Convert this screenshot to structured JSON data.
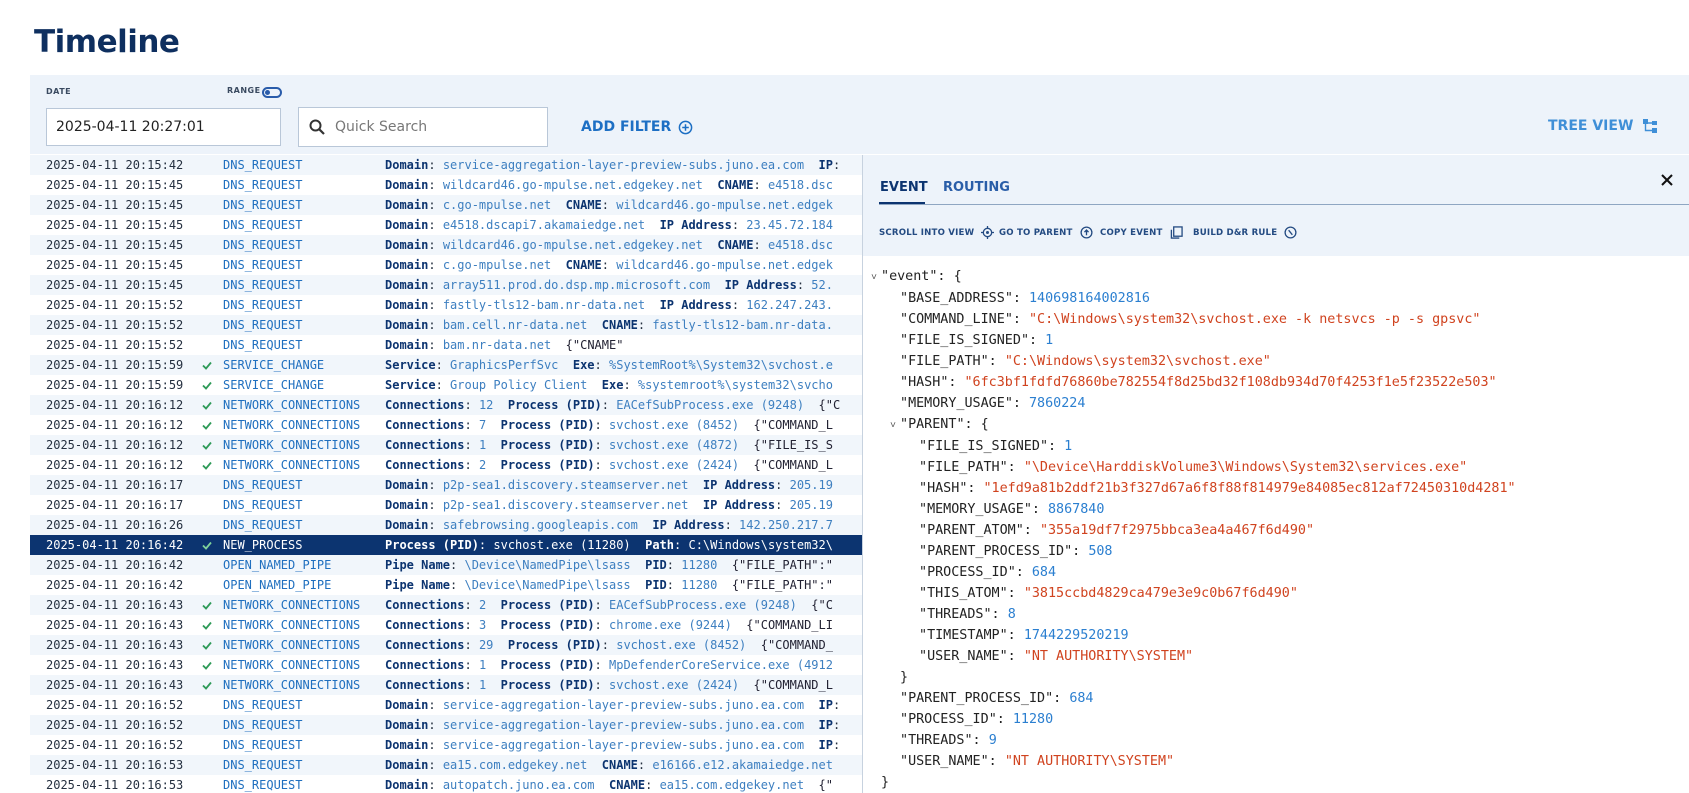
{
  "page": {
    "title": "Timeline"
  },
  "toolbar": {
    "date_label": "DATE",
    "range_label": "RANGE",
    "date_value": "2025-04-11 20:27:01",
    "search_placeholder": "Quick Search",
    "add_filter_label": "ADD FILTER",
    "tree_view_label": "TREE VIEW"
  },
  "events": [
    {
      "ts": "2025-04-11 20:15:42",
      "check": false,
      "type": "DNS_REQUEST",
      "fields": [
        [
          "Domain",
          "service-aggregation-layer-preview-subs.juno.ea.com"
        ],
        [
          "IP",
          ""
        ]
      ],
      "raw": ""
    },
    {
      "ts": "2025-04-11 20:15:45",
      "check": false,
      "type": "DNS_REQUEST",
      "fields": [
        [
          "Domain",
          "wildcard46.go-mpulse.net.edgekey.net"
        ],
        [
          "CNAME",
          "e4518.dsc"
        ]
      ],
      "raw": ""
    },
    {
      "ts": "2025-04-11 20:15:45",
      "check": false,
      "type": "DNS_REQUEST",
      "fields": [
        [
          "Domain",
          "c.go-mpulse.net"
        ],
        [
          "CNAME",
          "wildcard46.go-mpulse.net.edgek"
        ]
      ],
      "raw": ""
    },
    {
      "ts": "2025-04-11 20:15:45",
      "check": false,
      "type": "DNS_REQUEST",
      "fields": [
        [
          "Domain",
          "e4518.dscapi7.akamaiedge.net"
        ],
        [
          "IP Address",
          "23.45.72.184"
        ]
      ],
      "raw": ""
    },
    {
      "ts": "2025-04-11 20:15:45",
      "check": false,
      "type": "DNS_REQUEST",
      "fields": [
        [
          "Domain",
          "wildcard46.go-mpulse.net.edgekey.net"
        ],
        [
          "CNAME",
          "e4518.dsc"
        ]
      ],
      "raw": ""
    },
    {
      "ts": "2025-04-11 20:15:45",
      "check": false,
      "type": "DNS_REQUEST",
      "fields": [
        [
          "Domain",
          "c.go-mpulse.net"
        ],
        [
          "CNAME",
          "wildcard46.go-mpulse.net.edgek"
        ]
      ],
      "raw": ""
    },
    {
      "ts": "2025-04-11 20:15:45",
      "check": false,
      "type": "DNS_REQUEST",
      "fields": [
        [
          "Domain",
          "array511.prod.do.dsp.mp.microsoft.com"
        ],
        [
          "IP Address",
          "52."
        ]
      ],
      "raw": ""
    },
    {
      "ts": "2025-04-11 20:15:52",
      "check": false,
      "type": "DNS_REQUEST",
      "fields": [
        [
          "Domain",
          "fastly-tls12-bam.nr-data.net"
        ],
        [
          "IP Address",
          "162.247.243."
        ]
      ],
      "raw": ""
    },
    {
      "ts": "2025-04-11 20:15:52",
      "check": false,
      "type": "DNS_REQUEST",
      "fields": [
        [
          "Domain",
          "bam.cell.nr-data.net"
        ],
        [
          "CNAME",
          "fastly-tls12-bam.nr-data."
        ]
      ],
      "raw": ""
    },
    {
      "ts": "2025-04-11 20:15:52",
      "check": false,
      "type": "DNS_REQUEST",
      "fields": [
        [
          "Domain",
          "bam.nr-data.net"
        ]
      ],
      "raw": "{\"CNAME\""
    },
    {
      "ts": "2025-04-11 20:15:59",
      "check": true,
      "type": "SERVICE_CHANGE",
      "fields": [
        [
          "Service",
          "GraphicsPerfSvc"
        ],
        [
          "Exe",
          "%SystemRoot%\\System32\\svchost.e"
        ]
      ],
      "raw": ""
    },
    {
      "ts": "2025-04-11 20:15:59",
      "check": true,
      "type": "SERVICE_CHANGE",
      "fields": [
        [
          "Service",
          "Group Policy Client"
        ],
        [
          "Exe",
          "%systemroot%\\system32\\svcho"
        ]
      ],
      "raw": ""
    },
    {
      "ts": "2025-04-11 20:16:12",
      "check": true,
      "type": "NETWORK_CONNECTIONS",
      "fields": [
        [
          "Connections",
          "12"
        ],
        [
          "Process (PID)",
          "EACefSubProcess.exe (9248)"
        ]
      ],
      "raw": "{\"C"
    },
    {
      "ts": "2025-04-11 20:16:12",
      "check": true,
      "type": "NETWORK_CONNECTIONS",
      "fields": [
        [
          "Connections",
          "7"
        ],
        [
          "Process (PID)",
          "svchost.exe (8452)"
        ]
      ],
      "raw": "{\"COMMAND_L"
    },
    {
      "ts": "2025-04-11 20:16:12",
      "check": true,
      "type": "NETWORK_CONNECTIONS",
      "fields": [
        [
          "Connections",
          "1"
        ],
        [
          "Process (PID)",
          "svchost.exe (4872)"
        ]
      ],
      "raw": "{\"FILE_IS_S"
    },
    {
      "ts": "2025-04-11 20:16:12",
      "check": true,
      "type": "NETWORK_CONNECTIONS",
      "fields": [
        [
          "Connections",
          "2"
        ],
        [
          "Process (PID)",
          "svchost.exe (2424)"
        ]
      ],
      "raw": "{\"COMMAND_L"
    },
    {
      "ts": "2025-04-11 20:16:17",
      "check": false,
      "type": "DNS_REQUEST",
      "fields": [
        [
          "Domain",
          "p2p-sea1.discovery.steamserver.net"
        ],
        [
          "IP Address",
          "205.19"
        ]
      ],
      "raw": ""
    },
    {
      "ts": "2025-04-11 20:16:17",
      "check": false,
      "type": "DNS_REQUEST",
      "fields": [
        [
          "Domain",
          "p2p-sea1.discovery.steamserver.net"
        ],
        [
          "IP Address",
          "205.19"
        ]
      ],
      "raw": ""
    },
    {
      "ts": "2025-04-11 20:16:26",
      "check": false,
      "type": "DNS_REQUEST",
      "fields": [
        [
          "Domain",
          "safebrowsing.googleapis.com"
        ],
        [
          "IP Address",
          "142.250.217.7"
        ]
      ],
      "raw": ""
    },
    {
      "ts": "2025-04-11 20:16:42",
      "check": true,
      "type": "NEW_PROCESS",
      "selected": true,
      "fields": [
        [
          "Process (PID)",
          "svchost.exe (11280)"
        ],
        [
          "Path",
          "C:\\Windows\\system32\\"
        ]
      ],
      "raw": ""
    },
    {
      "ts": "2025-04-11 20:16:42",
      "check": false,
      "type": "OPEN_NAMED_PIPE",
      "fields": [
        [
          "Pipe Name",
          "\\Device\\NamedPipe\\lsass"
        ],
        [
          "PID",
          "11280"
        ]
      ],
      "raw": "{\"FILE_PATH\":\""
    },
    {
      "ts": "2025-04-11 20:16:42",
      "check": false,
      "type": "OPEN_NAMED_PIPE",
      "fields": [
        [
          "Pipe Name",
          "\\Device\\NamedPipe\\lsass"
        ],
        [
          "PID",
          "11280"
        ]
      ],
      "raw": "{\"FILE_PATH\":\""
    },
    {
      "ts": "2025-04-11 20:16:43",
      "check": true,
      "type": "NETWORK_CONNECTIONS",
      "fields": [
        [
          "Connections",
          "2"
        ],
        [
          "Process (PID)",
          "EACefSubProcess.exe (9248)"
        ]
      ],
      "raw": "{\"C"
    },
    {
      "ts": "2025-04-11 20:16:43",
      "check": true,
      "type": "NETWORK_CONNECTIONS",
      "fields": [
        [
          "Connections",
          "3"
        ],
        [
          "Process (PID)",
          "chrome.exe (9244)"
        ]
      ],
      "raw": "{\"COMMAND_LI"
    },
    {
      "ts": "2025-04-11 20:16:43",
      "check": true,
      "type": "NETWORK_CONNECTIONS",
      "fields": [
        [
          "Connections",
          "29"
        ],
        [
          "Process (PID)",
          "svchost.exe (8452)"
        ]
      ],
      "raw": "{\"COMMAND_"
    },
    {
      "ts": "2025-04-11 20:16:43",
      "check": true,
      "type": "NETWORK_CONNECTIONS",
      "fields": [
        [
          "Connections",
          "1"
        ],
        [
          "Process (PID)",
          "MpDefenderCoreService.exe (4912"
        ]
      ],
      "raw": ""
    },
    {
      "ts": "2025-04-11 20:16:43",
      "check": true,
      "type": "NETWORK_CONNECTIONS",
      "fields": [
        [
          "Connections",
          "1"
        ],
        [
          "Process (PID)",
          "svchost.exe (2424)"
        ]
      ],
      "raw": "{\"COMMAND_L"
    },
    {
      "ts": "2025-04-11 20:16:52",
      "check": false,
      "type": "DNS_REQUEST",
      "fields": [
        [
          "Domain",
          "service-aggregation-layer-preview-subs.juno.ea.com"
        ],
        [
          "IP",
          ""
        ]
      ],
      "raw": ""
    },
    {
      "ts": "2025-04-11 20:16:52",
      "check": false,
      "type": "DNS_REQUEST",
      "fields": [
        [
          "Domain",
          "service-aggregation-layer-preview-subs.juno.ea.com"
        ],
        [
          "IP",
          ""
        ]
      ],
      "raw": ""
    },
    {
      "ts": "2025-04-11 20:16:52",
      "check": false,
      "type": "DNS_REQUEST",
      "fields": [
        [
          "Domain",
          "service-aggregation-layer-preview-subs.juno.ea.com"
        ],
        [
          "IP",
          ""
        ]
      ],
      "raw": ""
    },
    {
      "ts": "2025-04-11 20:16:53",
      "check": false,
      "type": "DNS_REQUEST",
      "fields": [
        [
          "Domain",
          "ea15.com.edgekey.net"
        ],
        [
          "CNAME",
          "e16166.e12.akamaiedge.net"
        ]
      ],
      "raw": ""
    },
    {
      "ts": "2025-04-11 20:16:53",
      "check": false,
      "type": "DNS_REQUEST",
      "fields": [
        [
          "Domain",
          "autopatch.juno.ea.com"
        ],
        [
          "CNAME",
          "ea15.com.edgekey.net"
        ]
      ],
      "raw": "{\""
    }
  ],
  "panel": {
    "tabs": [
      "EVENT",
      "ROUTING"
    ],
    "actions": [
      "SCROLL INTO VIEW",
      "GO TO PARENT",
      "COPY EVENT",
      "BUILD D&R RULE"
    ],
    "json_lines": [
      {
        "indent": 0,
        "caret": true,
        "key": "event",
        "open": "{"
      },
      {
        "indent": 1,
        "key": "BASE_ADDRESS",
        "val": "140698164002816",
        "t": "n"
      },
      {
        "indent": 1,
        "key": "COMMAND_LINE",
        "val": "\"C:\\Windows\\system32\\svchost.exe -k netsvcs -p -s gpsvc\"",
        "t": "s"
      },
      {
        "indent": 1,
        "key": "FILE_IS_SIGNED",
        "val": "1",
        "t": "n"
      },
      {
        "indent": 1,
        "key": "FILE_PATH",
        "val": "\"C:\\Windows\\system32\\svchost.exe\"",
        "t": "s"
      },
      {
        "indent": 1,
        "key": "HASH",
        "val": "\"6fc3bf1fdfd76860be782554f8d25bd32f108db934d70f4253f1e5f23522e503\"",
        "t": "s"
      },
      {
        "indent": 1,
        "key": "MEMORY_USAGE",
        "val": "7860224",
        "t": "n"
      },
      {
        "indent": 1,
        "caret": true,
        "key": "PARENT",
        "open": "{"
      },
      {
        "indent": 2,
        "key": "FILE_IS_SIGNED",
        "val": "1",
        "t": "n"
      },
      {
        "indent": 2,
        "key": "FILE_PATH",
        "val": "\"\\Device\\HarddiskVolume3\\Windows\\System32\\services.exe\"",
        "t": "s"
      },
      {
        "indent": 2,
        "key": "HASH",
        "val": "\"1efd9a81b2ddf21b3f327d67a6f8f88f814979e84085ec812af72450310d4281\"",
        "t": "s"
      },
      {
        "indent": 2,
        "key": "MEMORY_USAGE",
        "val": "8867840",
        "t": "n"
      },
      {
        "indent": 2,
        "key": "PARENT_ATOM",
        "val": "\"355a19df7f2975bbca3ea4a467f6d490\"",
        "t": "s"
      },
      {
        "indent": 2,
        "key": "PARENT_PROCESS_ID",
        "val": "508",
        "t": "n"
      },
      {
        "indent": 2,
        "key": "PROCESS_ID",
        "val": "684",
        "t": "n"
      },
      {
        "indent": 2,
        "key": "THIS_ATOM",
        "val": "\"3815ccbd4829ca479e3e9c0b67f6d490\"",
        "t": "s"
      },
      {
        "indent": 2,
        "key": "THREADS",
        "val": "8",
        "t": "n"
      },
      {
        "indent": 2,
        "key": "TIMESTAMP",
        "val": "1744229520219",
        "t": "n"
      },
      {
        "indent": 2,
        "key": "USER_NAME",
        "val": "\"NT AUTHORITY\\SYSTEM\"",
        "t": "s"
      },
      {
        "indent": 1,
        "close": "}"
      },
      {
        "indent": 1,
        "key": "PARENT_PROCESS_ID",
        "val": "684",
        "t": "n"
      },
      {
        "indent": 1,
        "key": "PROCESS_ID",
        "val": "11280",
        "t": "n"
      },
      {
        "indent": 1,
        "key": "THREADS",
        "val": "9",
        "t": "n"
      },
      {
        "indent": 1,
        "key": "USER_NAME",
        "val": "\"NT AUTHORITY\\SYSTEM\"",
        "t": "s"
      },
      {
        "indent": 0,
        "close": "}"
      }
    ]
  },
  "colors": {
    "accent": "#0c3470",
    "link": "#1f6fbf",
    "string": "#d0431f",
    "number": "#2b7fd0",
    "check": "#2e9a58"
  }
}
